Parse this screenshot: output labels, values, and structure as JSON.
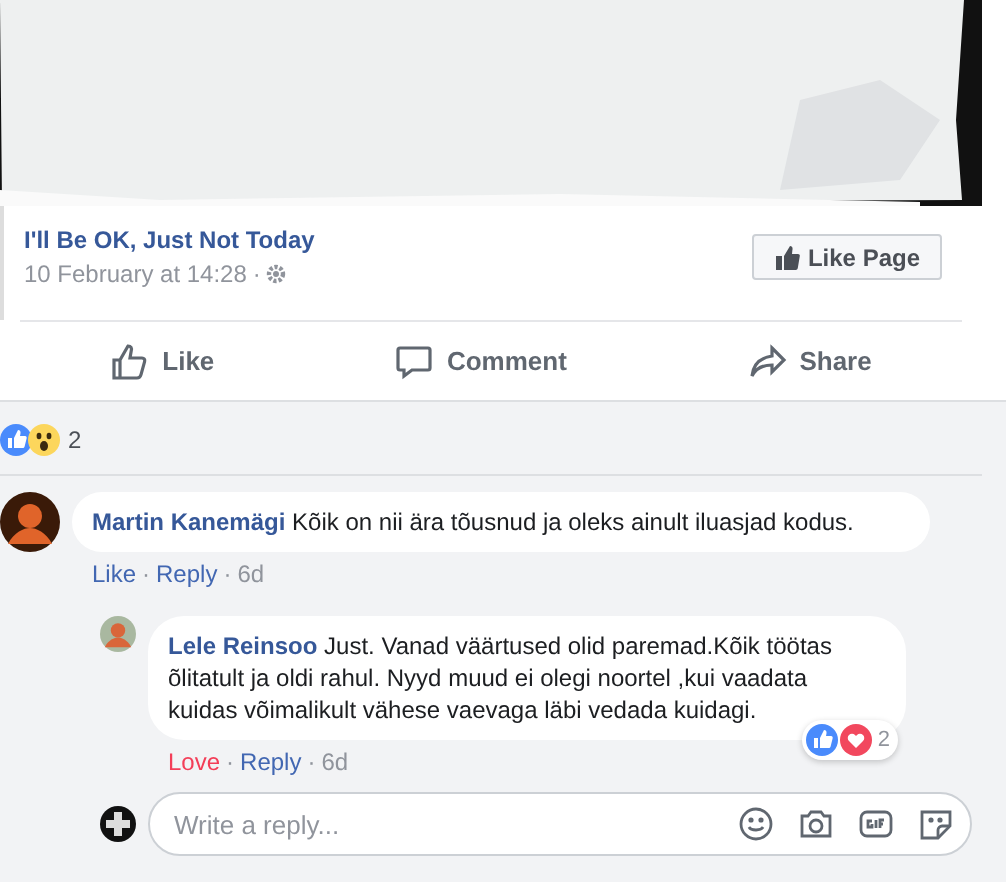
{
  "post": {
    "page_name": "I'll Be OK, Just Not Today",
    "timestamp": "10 February at 14:28",
    "separator": "·",
    "like_page_button": "Like Page"
  },
  "actions": [
    {
      "kind": "like",
      "label": "Like"
    },
    {
      "kind": "comment",
      "label": "Comment"
    },
    {
      "kind": "share",
      "label": "Share"
    }
  ],
  "reactions": {
    "types": [
      {
        "kind": "like"
      },
      {
        "kind": "wow"
      }
    ],
    "count": "2"
  },
  "comments": [
    {
      "author": "Martin Kanemägi",
      "text": "Kõik on nii ära tõusnud ja oleks ainult iluasjad kodus.",
      "actions": [
        {
          "label": "Like",
          "reacted": false
        },
        {
          "label": "Reply",
          "reacted": false
        }
      ],
      "separator": "·",
      "age": "6d",
      "replies": [
        {
          "author": "Lele Reinsoo",
          "text": "Just. Vanad väärtused olid paremad.Kõik töötas õlitatult ja oldi rahul. Nyyd muud ei olegi noortel ,kui vaadata kuidas võimalikult vähese vaevaga läbi vedada kuidagi.",
          "actions": [
            {
              "label": "Love",
              "reacted": true
            },
            {
              "label": "Reply",
              "reacted": false
            }
          ],
          "separator": "·",
          "age": "6d",
          "reaction_types": [
            {
              "kind": "like"
            },
            {
              "kind": "love"
            }
          ],
          "reaction_count": "2"
        }
      ]
    }
  ],
  "reply_box": {
    "placeholder": "Write a reply..."
  }
}
